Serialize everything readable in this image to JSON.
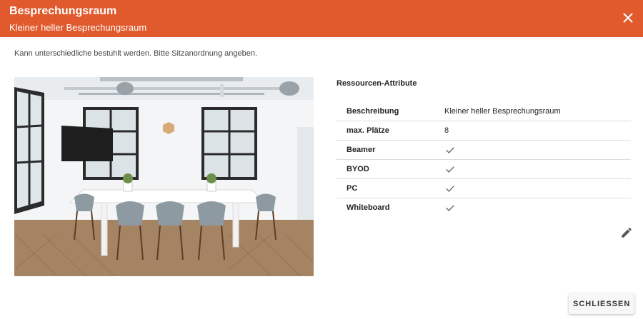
{
  "header": {
    "title": "Besprechungsraum",
    "subtitle": "Kleiner heller Besprechungsraum",
    "close_icon": "close-icon"
  },
  "description": "Kann unterschiedliche bestuhlt werden. Bitte Sitzanordnung angeben.",
  "image": {
    "alt": "meeting-room-photo"
  },
  "attributes": {
    "title": "Ressourcen-Attribute",
    "rows": [
      {
        "label": "Beschreibung",
        "value": "Kleiner heller Besprechungsraum"
      },
      {
        "label": "max. Plätze",
        "value": "8"
      },
      {
        "label": "Beamer",
        "icon": "check-icon"
      },
      {
        "label": "BYOD",
        "icon": "check-icon"
      },
      {
        "label": "PC",
        "icon": "check-icon"
      },
      {
        "label": "Whiteboard",
        "icon": "check-icon"
      }
    ]
  },
  "edit_icon": "pencil-icon",
  "footer": {
    "close_label": "SCHLIESSEN"
  },
  "colors": {
    "header_bg": "#e05a2e",
    "header_text": "#ffffff"
  }
}
